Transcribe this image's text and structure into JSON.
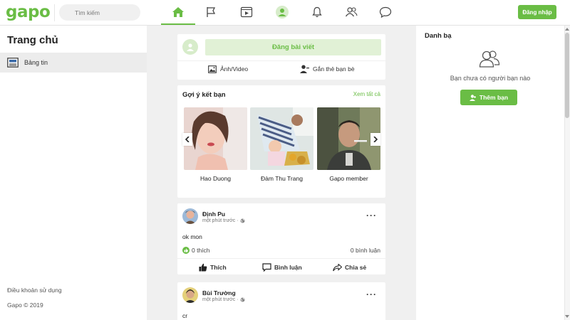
{
  "header": {
    "logo": "gapo",
    "search_placeholder": "Tìm kiếm",
    "login_label": "Đăng nhập",
    "nav": [
      "home-icon",
      "flag-icon",
      "video-icon",
      "profile-icon",
      "bell-icon",
      "friends-icon",
      "chat-icon"
    ]
  },
  "left": {
    "title": "Trang chủ",
    "item_label": "Bảng tin",
    "terms": "Điều khoản sử dụng",
    "copyright": "Gapo © 2019"
  },
  "composer": {
    "post_label": "Đăng bài viết",
    "photo_video": "Ảnh/Video",
    "tag_friends": "Gắn thẻ bạn bè"
  },
  "suggestions": {
    "title": "Gợi ý kết bạn",
    "see_all": "Xem tất cả",
    "people": [
      "Hao Duong",
      "Đàm Thu Trang",
      "Gapo member"
    ]
  },
  "posts": [
    {
      "author": "Định Pu",
      "time": "một phút trước ·",
      "text": "ok mon",
      "likes": "0 thích",
      "comments": "0 bình luận"
    },
    {
      "author": "Bùi Trường",
      "time": "một phút trước ·",
      "text": "cr"
    }
  ],
  "post_actions": {
    "like": "Thích",
    "comment": "Bình luận",
    "share": "Chia sẻ"
  },
  "right": {
    "title": "Danh bạ",
    "empty": "Bạn chưa có người bạn nào",
    "add_friend": "Thêm bạn"
  },
  "colors": {
    "accent": "#6abd45",
    "accent_light": "#e1f1d6"
  }
}
